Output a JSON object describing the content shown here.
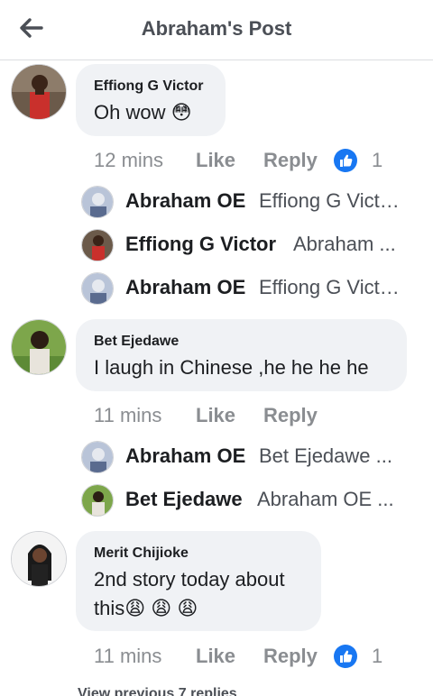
{
  "header": {
    "title": "Abraham's Post"
  },
  "comments": [
    {
      "author": "Effiong G Victor",
      "text": "Oh wow 😳",
      "time": "12 mins",
      "like_label": "Like",
      "reply_label": "Reply",
      "reaction_count": "1",
      "replies": [
        {
          "name": "Abraham OE",
          "text": "Effiong G Victor ..."
        },
        {
          "name": "Effiong G Victor",
          "text": "Abraham ..."
        },
        {
          "name": "Abraham OE",
          "text": "Effiong G Victor ..."
        }
      ]
    },
    {
      "author": "Bet Ejedawe",
      "text": "I laugh in Chinese ,he  he he he",
      "time": "11 mins",
      "like_label": "Like",
      "reply_label": "Reply",
      "replies": [
        {
          "name": "Abraham OE",
          "text": "Bet Ejedawe ..."
        },
        {
          "name": "Bet Ejedawe",
          "text": "Abraham OE ..."
        }
      ]
    },
    {
      "author": "Merit Chijioke",
      "text_line1": "2nd story today about",
      "text_line2": "this😩 😩 😩",
      "time": "11 mins",
      "like_label": "Like",
      "reply_label": "Reply",
      "reaction_count": "1"
    }
  ],
  "footer": {
    "view_previous": "View previous 7 replies"
  },
  "colors": {
    "accent_blue": "#1877f2",
    "bubble_bg": "#f0f2f5",
    "muted_text": "#8a8d91"
  }
}
